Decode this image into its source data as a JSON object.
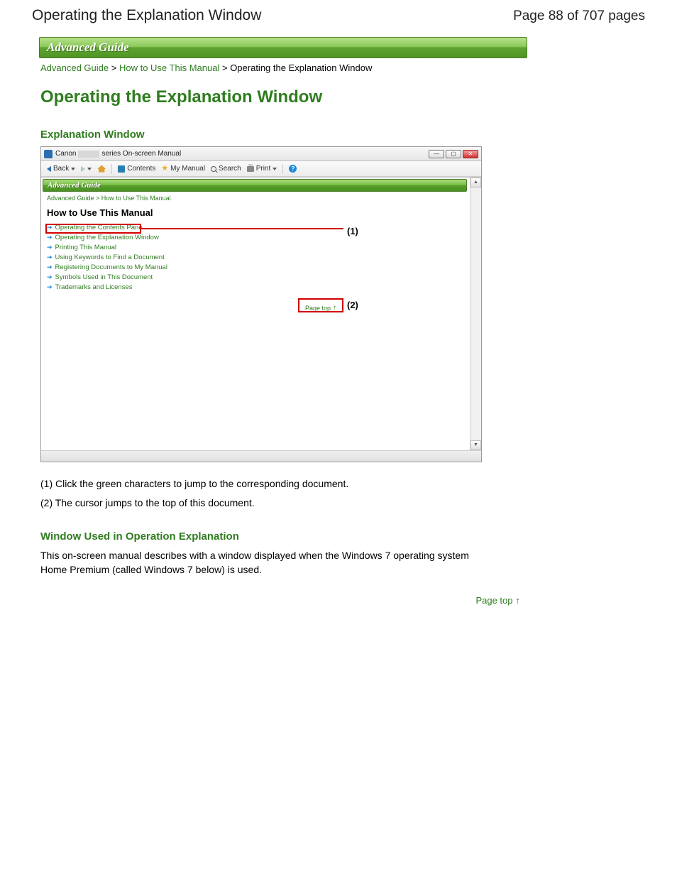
{
  "header": {
    "title": "Operating the Explanation Window",
    "page_indicator": "Page 88 of 707 pages"
  },
  "banner": "Advanced Guide",
  "breadcrumbs": {
    "items": [
      "Advanced Guide",
      "How to Use This Manual",
      "Operating the Explanation Window"
    ],
    "sep": " > "
  },
  "h1": "Operating the Explanation Window",
  "section1_heading": "Explanation Window",
  "screenshot": {
    "titlebar_prefix": "Canon",
    "titlebar_suffix": "series On-screen Manual",
    "toolbar": {
      "back": "Back",
      "contents": "Contents",
      "my_manual": "My Manual",
      "search": "Search",
      "print": "Print"
    },
    "mini_banner": "Advanced Guide",
    "mini_breadcrumb": "Advanced Guide > How to Use This Manual",
    "mini_heading": "How to Use This Manual",
    "links": [
      "Operating the Contents Pane",
      "Operating the Explanation Window",
      "Printing This Manual",
      "Using Keywords to Find a Document",
      "Registering Documents to My Manual",
      "Symbols Used in This Document",
      "Trademarks and Licenses"
    ],
    "page_top": "Page top",
    "callout1": "(1)",
    "callout2": "(2)"
  },
  "notes": {
    "n1": "(1) Click the green characters to jump to the corresponding document.",
    "n2": "(2) The cursor jumps to the top of this document."
  },
  "section2_heading": "Window Used in Operation Explanation",
  "section2_body": "This on-screen manual describes with a window displayed when the Windows 7 operating system Home Premium (called Windows 7 below) is used.",
  "page_top_label": "Page top"
}
